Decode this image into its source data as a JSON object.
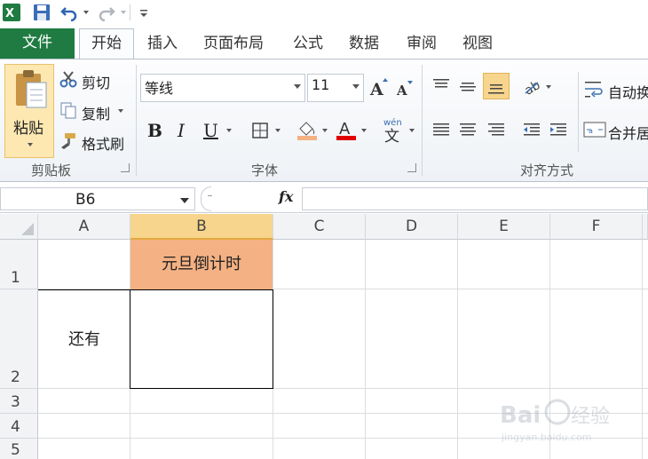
{
  "quick_access": {
    "icons": [
      "excel-icon",
      "save-icon",
      "undo-icon",
      "redo-icon",
      "customize-icon"
    ]
  },
  "tabs": {
    "file": "文件",
    "items": [
      "开始",
      "插入",
      "页面布局",
      "公式",
      "数据",
      "审阅",
      "视图"
    ]
  },
  "clipboard": {
    "paste": "粘贴",
    "cut": "剪切",
    "copy": "复制",
    "format_painter": "格式刷",
    "label": "剪贴板"
  },
  "font": {
    "name": "等线",
    "size": "11",
    "bold": "B",
    "italic": "I",
    "underline": "U",
    "font_color_letter": "A",
    "label": "字体"
  },
  "alignment": {
    "wrap": "自动换",
    "merge": "合并居",
    "label": "对齐方式"
  },
  "formula_bar": {
    "name_box": "B6",
    "fx": "fx",
    "content": ""
  },
  "sheet": {
    "columns": [
      "A",
      "B",
      "C",
      "D",
      "E",
      "F"
    ],
    "rows": [
      "1",
      "2",
      "3",
      "4",
      "5"
    ],
    "cells": {
      "B1": "元旦倒计时",
      "A2": "还有",
      "B2": ""
    }
  },
  "colors": {
    "accent_green": "#1f7b41",
    "header_fill": "#f4b183",
    "font_red": "#e00000",
    "selected_col": "#f7d58c"
  },
  "watermark": {
    "text": "Baidu经验",
    "sub": "jingyan.baidu.com"
  }
}
